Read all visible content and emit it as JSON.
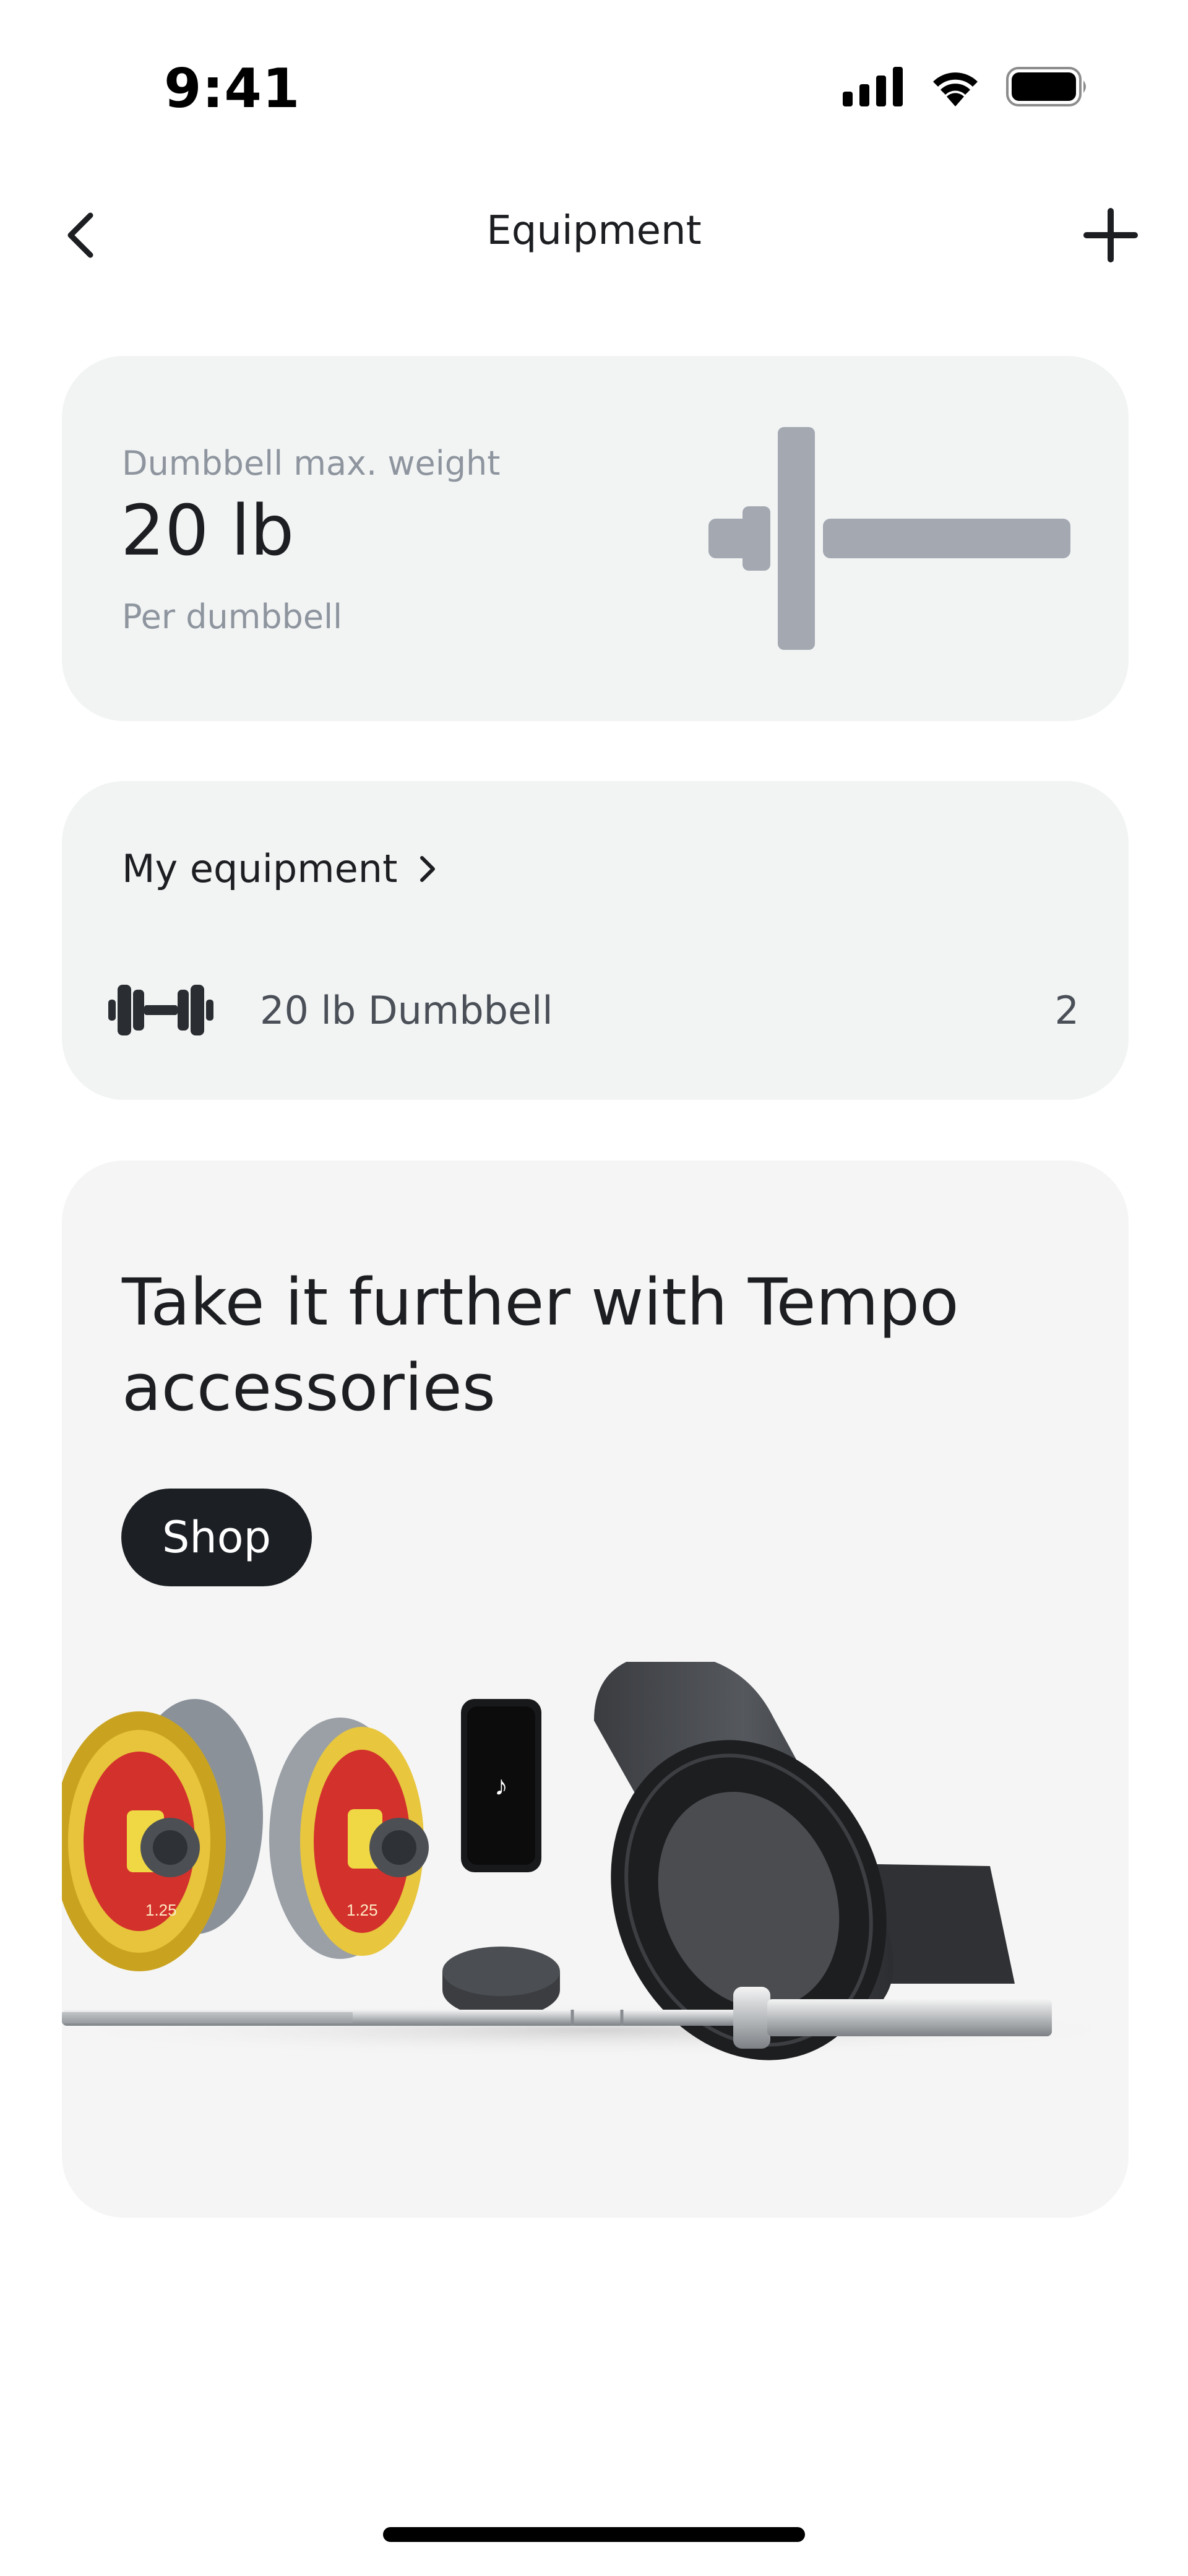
{
  "status_bar": {
    "time": "9:41"
  },
  "nav": {
    "title": "Equipment",
    "back_icon": "chevron-left-icon",
    "add_icon": "plus-icon"
  },
  "max_weight_card": {
    "label": "Dumbbell max. weight",
    "value": "20 lb",
    "subtitle": "Per dumbbell"
  },
  "equipment_card": {
    "header": "My equipment",
    "items": [
      {
        "icon": "dumbbell-icon",
        "label": "20 lb Dumbbell",
        "count": "2"
      }
    ]
  },
  "promo_card": {
    "title": "Take it further with Tempo accessories",
    "button_label": "Shop",
    "plate_label": "1.25"
  },
  "colors": {
    "card_background": "#f2f4f4",
    "primary_text": "#1c1e21",
    "secondary_text": "#8e959e",
    "button_background": "#1c1f24",
    "graphic_gray": "#a3a8b1"
  }
}
